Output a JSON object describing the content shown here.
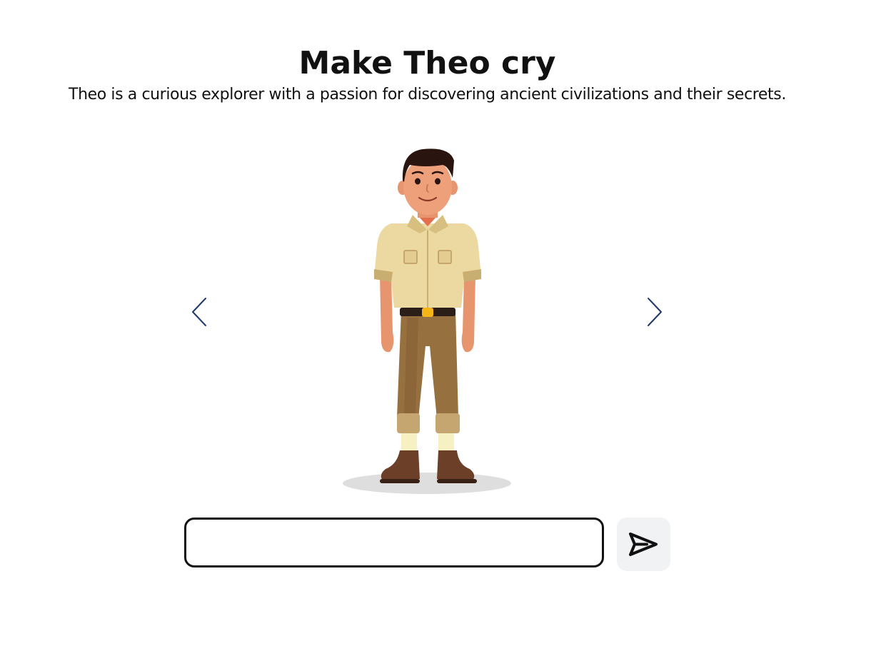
{
  "page": {
    "title": "Make Theo cry",
    "description": "Theo is a curious explorer with a passion for discovering ancient civilizations and their secrets."
  },
  "carousel": {
    "prev_icon": "chevron-left-icon",
    "next_icon": "chevron-right-icon",
    "character_image": "explorer-character-illustration"
  },
  "chat": {
    "input_value": "",
    "input_placeholder": "",
    "send_icon": "paper-plane-send-icon"
  },
  "colors": {
    "text": "#111111",
    "nav_arrow": "#1f3a6e",
    "send_button_bg": "#f1f2f4",
    "input_border": "#111111"
  }
}
